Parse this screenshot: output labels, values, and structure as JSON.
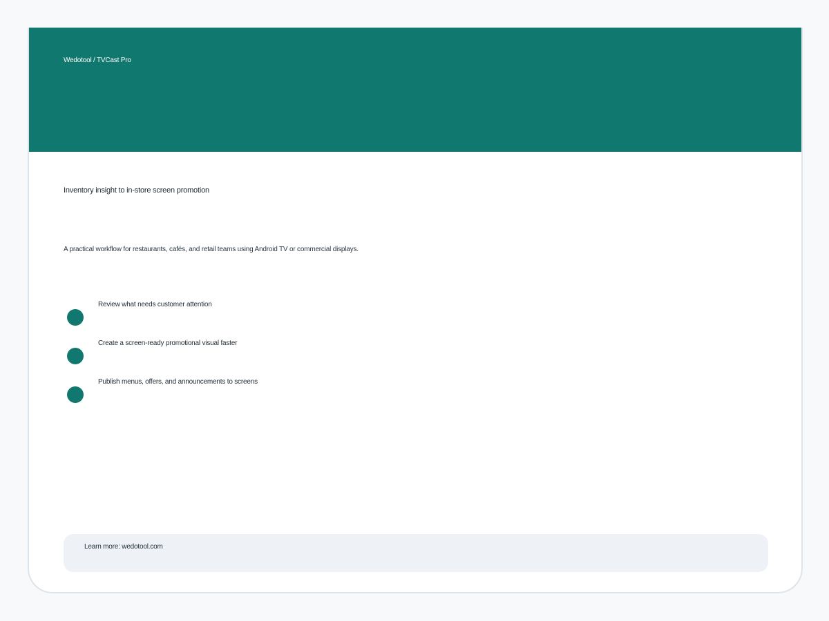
{
  "header": {
    "brand": "Wedotool / TVCast Pro",
    "color": "#11786f"
  },
  "main": {
    "title": "Inventory insight to in-store screen promotion",
    "subtitle": "A practical workflow for restaurants, cafés, and retail teams using Android TV or commercial displays.",
    "steps": [
      {
        "label": "Review what needs customer attention"
      },
      {
        "label": "Create a screen-ready promotional visual faster"
      },
      {
        "label": "Publish menus, offers, and announcements to screens"
      }
    ]
  },
  "footer": {
    "text": "Learn more: wedotool.com"
  }
}
